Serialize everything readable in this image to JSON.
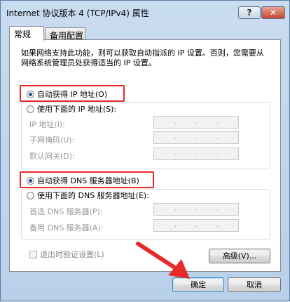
{
  "window": {
    "title": "Internet 协议版本 4 (TCP/IPv4) 属性",
    "help_label": "?",
    "close_label": "✕"
  },
  "tabs": [
    {
      "label": "常规"
    },
    {
      "label": "备用配置"
    }
  ],
  "description": "如果网络支持此功能，则可以获取自动指派的 IP 设置。否则，您需要从网络系统管理员处获得适当的 IP 设置。",
  "ip_section": {
    "auto_label": "自动获得 IP 地址(O)",
    "manual_label": "使用下面的 IP 地址(S):",
    "fields": [
      {
        "label": "IP 地址(I):"
      },
      {
        "label": "子网掩码(U):"
      },
      {
        "label": "默认网关(D):"
      }
    ]
  },
  "dns_section": {
    "auto_label": "自动获得 DNS 服务器地址(B)",
    "manual_label": "使用下面的 DNS 服务器地址(E):",
    "fields": [
      {
        "label": "首选 DNS 服务器(P):"
      },
      {
        "label": "备用 DNS 服务器(A):"
      }
    ]
  },
  "validate_label": "退出时验证设置(L)",
  "advanced_label": "高级(V)...",
  "ok_label": "确定",
  "cancel_label": "取消",
  "colors": {
    "highlight": "#e8292a",
    "arrow": "#e8292a"
  },
  "icons": [
    "help-icon",
    "close-icon",
    "arrow-annotation"
  ]
}
